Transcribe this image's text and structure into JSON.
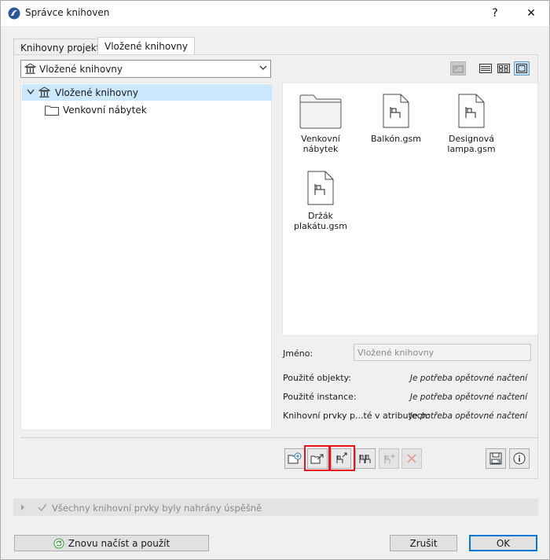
{
  "window": {
    "title": "Správce knihoven",
    "help_label": "?",
    "close_label": "✕"
  },
  "tabs": [
    {
      "label": "Knihovny projektu"
    },
    {
      "label": "Vložené knihovny"
    }
  ],
  "combo": {
    "value": "Vložené knihovny"
  },
  "tree": {
    "items": [
      {
        "label": "Vložené knihovny"
      },
      {
        "label": "Venkovní nábytek"
      }
    ]
  },
  "grid": {
    "items": [
      {
        "line1": "Venkovní",
        "line2": "nábytek",
        "icon": "folder-icon"
      },
      {
        "line1": "Balkón.gsm",
        "line2": "",
        "icon": "object-file-icon"
      },
      {
        "line1": "Designová",
        "line2": "lampa.gsm",
        "icon": "object-file-icon"
      },
      {
        "line1": "Držák",
        "line2": "plakátu.gsm",
        "icon": "object-file-icon"
      }
    ]
  },
  "info": {
    "name_label": "Jméno:",
    "name_placeholder": "Vložené knihovny",
    "rows": [
      {
        "label": "Použité objekty:",
        "value": "Je potřeba opětovné načtení"
      },
      {
        "label": "Použité instance:",
        "value": "Je potřeba opětovné načtení"
      },
      {
        "label": "Knihovní prvky p...té v atributech:",
        "value": "Je potřeba opětovné načtení"
      }
    ]
  },
  "status": {
    "message": "Všechny knihovní prvky byly nahrány úspěšně"
  },
  "buttons": {
    "reload": "Znovu načíst a použít",
    "cancel": "Zrušit",
    "ok": "OK"
  },
  "colors": {
    "selection": "#cce8ff",
    "highlight": "#e8141a",
    "accent": "#0078d7"
  }
}
